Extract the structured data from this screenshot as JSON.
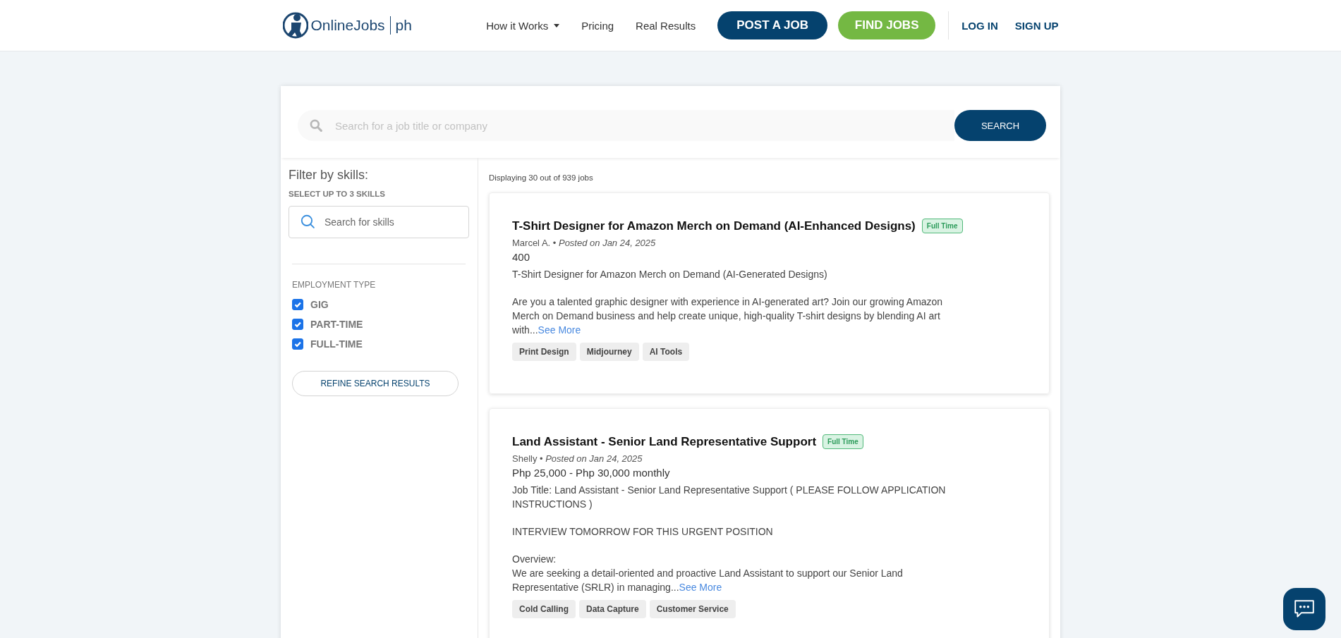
{
  "header": {
    "logo": {
      "name": "OnlineJobs",
      "suffix": "ph"
    },
    "nav": [
      {
        "label": "How it Works",
        "kind": "dropdown"
      },
      {
        "label": "Pricing",
        "kind": "link"
      },
      {
        "label": "Real Results",
        "kind": "link"
      },
      {
        "label": "POST A JOB",
        "kind": "primary"
      },
      {
        "label": "FIND JOBS",
        "kind": "accent"
      }
    ],
    "auth": [
      "LOG IN",
      "SIGN UP"
    ]
  },
  "search": {
    "placeholder": "Search for a job title or company",
    "button": "SEARCH"
  },
  "sidebar": {
    "title": "Filter by skills:",
    "subtitle": "SELECT UP TO 3 SKILLS",
    "skill_search": {
      "placeholder": "Search for skills"
    },
    "employment_heading": "EMPLOYMENT TYPE",
    "employment_types": [
      {
        "label": "GIG",
        "checked": true
      },
      {
        "label": "PART-TIME",
        "checked": true
      },
      {
        "label": "FULL-TIME",
        "checked": true
      }
    ],
    "refine_button": "REFINE SEARCH RESULTS"
  },
  "results_count": "Displaying 30 out of 939 jobs",
  "jobs": [
    {
      "title": "T-Shirt Designer for Amazon Merch on Demand (AI-Enhanced Designs)",
      "badge": "Full Time",
      "byline": "Marcel A. • *Posted on Jan 24, 2025*",
      "pay": "400",
      "paragraphs": [
        "T-Shirt Designer for Amazon Merch on Demand (AI-Generated Designs)",
        "Are you a talented graphic designer with experience in AI-generated art? Join our growing Amazon Merch on Demand business and help create unique, high-quality T-shirt designs by blending AI art with..."
      ],
      "see_more": "See More",
      "skills": [
        "Print Design",
        "Midjourney",
        "AI Tools"
      ]
    },
    {
      "title": "Land Assistant - Senior Land Representative Support",
      "badge": "Full Time",
      "byline": "Shelly • *Posted on Jan 24, 2025*",
      "pay": "Php 25,000 - Php 30,000 monthly",
      "paragraphs": [
        "Job Title: Land Assistant - Senior Land Representative Support ( PLEASE FOLLOW APPLICATION INSTRUCTIONS )",
        "INTERVIEW TOMORROW FOR THIS URGENT POSITION",
        "Overview:\nWe are seeking a detail-oriented and proactive Land Assistant to support our Senior Land Representative (SRLR) in managing..."
      ],
      "see_more": "See More",
      "skills": [
        "Cold Calling",
        "Data Capture",
        "Customer Service"
      ]
    }
  ]
}
